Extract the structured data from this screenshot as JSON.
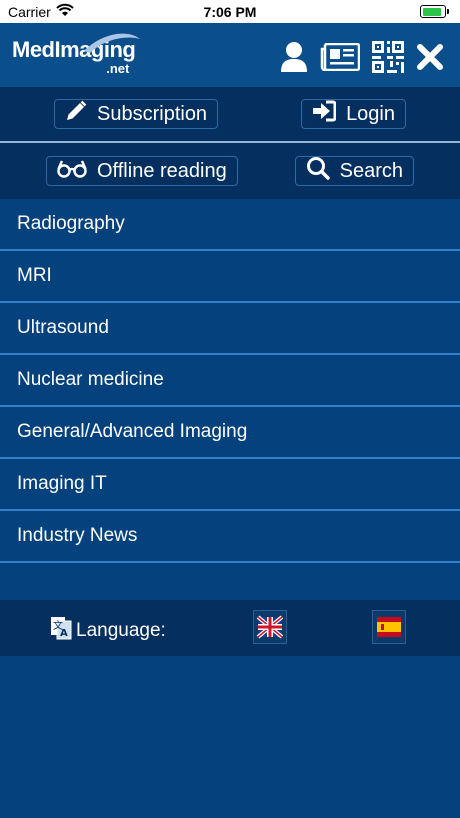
{
  "status": {
    "carrier": "Carrier",
    "time": "7:06 PM"
  },
  "header": {
    "logo_main": "MedImaging",
    "logo_net": ".net"
  },
  "buttons": {
    "subscription": "Subscription",
    "login": "Login",
    "offline": "Offline reading",
    "search": "Search"
  },
  "menu": [
    "Radiography",
    "MRI",
    "Ultrasound",
    "Nuclear medicine",
    "General/Advanced Imaging",
    "Imaging IT",
    "Industry News"
  ],
  "language": {
    "label": "Language:"
  },
  "icons": [
    "user-icon",
    "newspaper-icon",
    "qr-code-icon",
    "close-icon",
    "pencil-icon",
    "sign-in-icon",
    "glasses-icon",
    "search-icon",
    "translate-icon",
    "uk-flag-icon",
    "spain-flag-icon"
  ]
}
